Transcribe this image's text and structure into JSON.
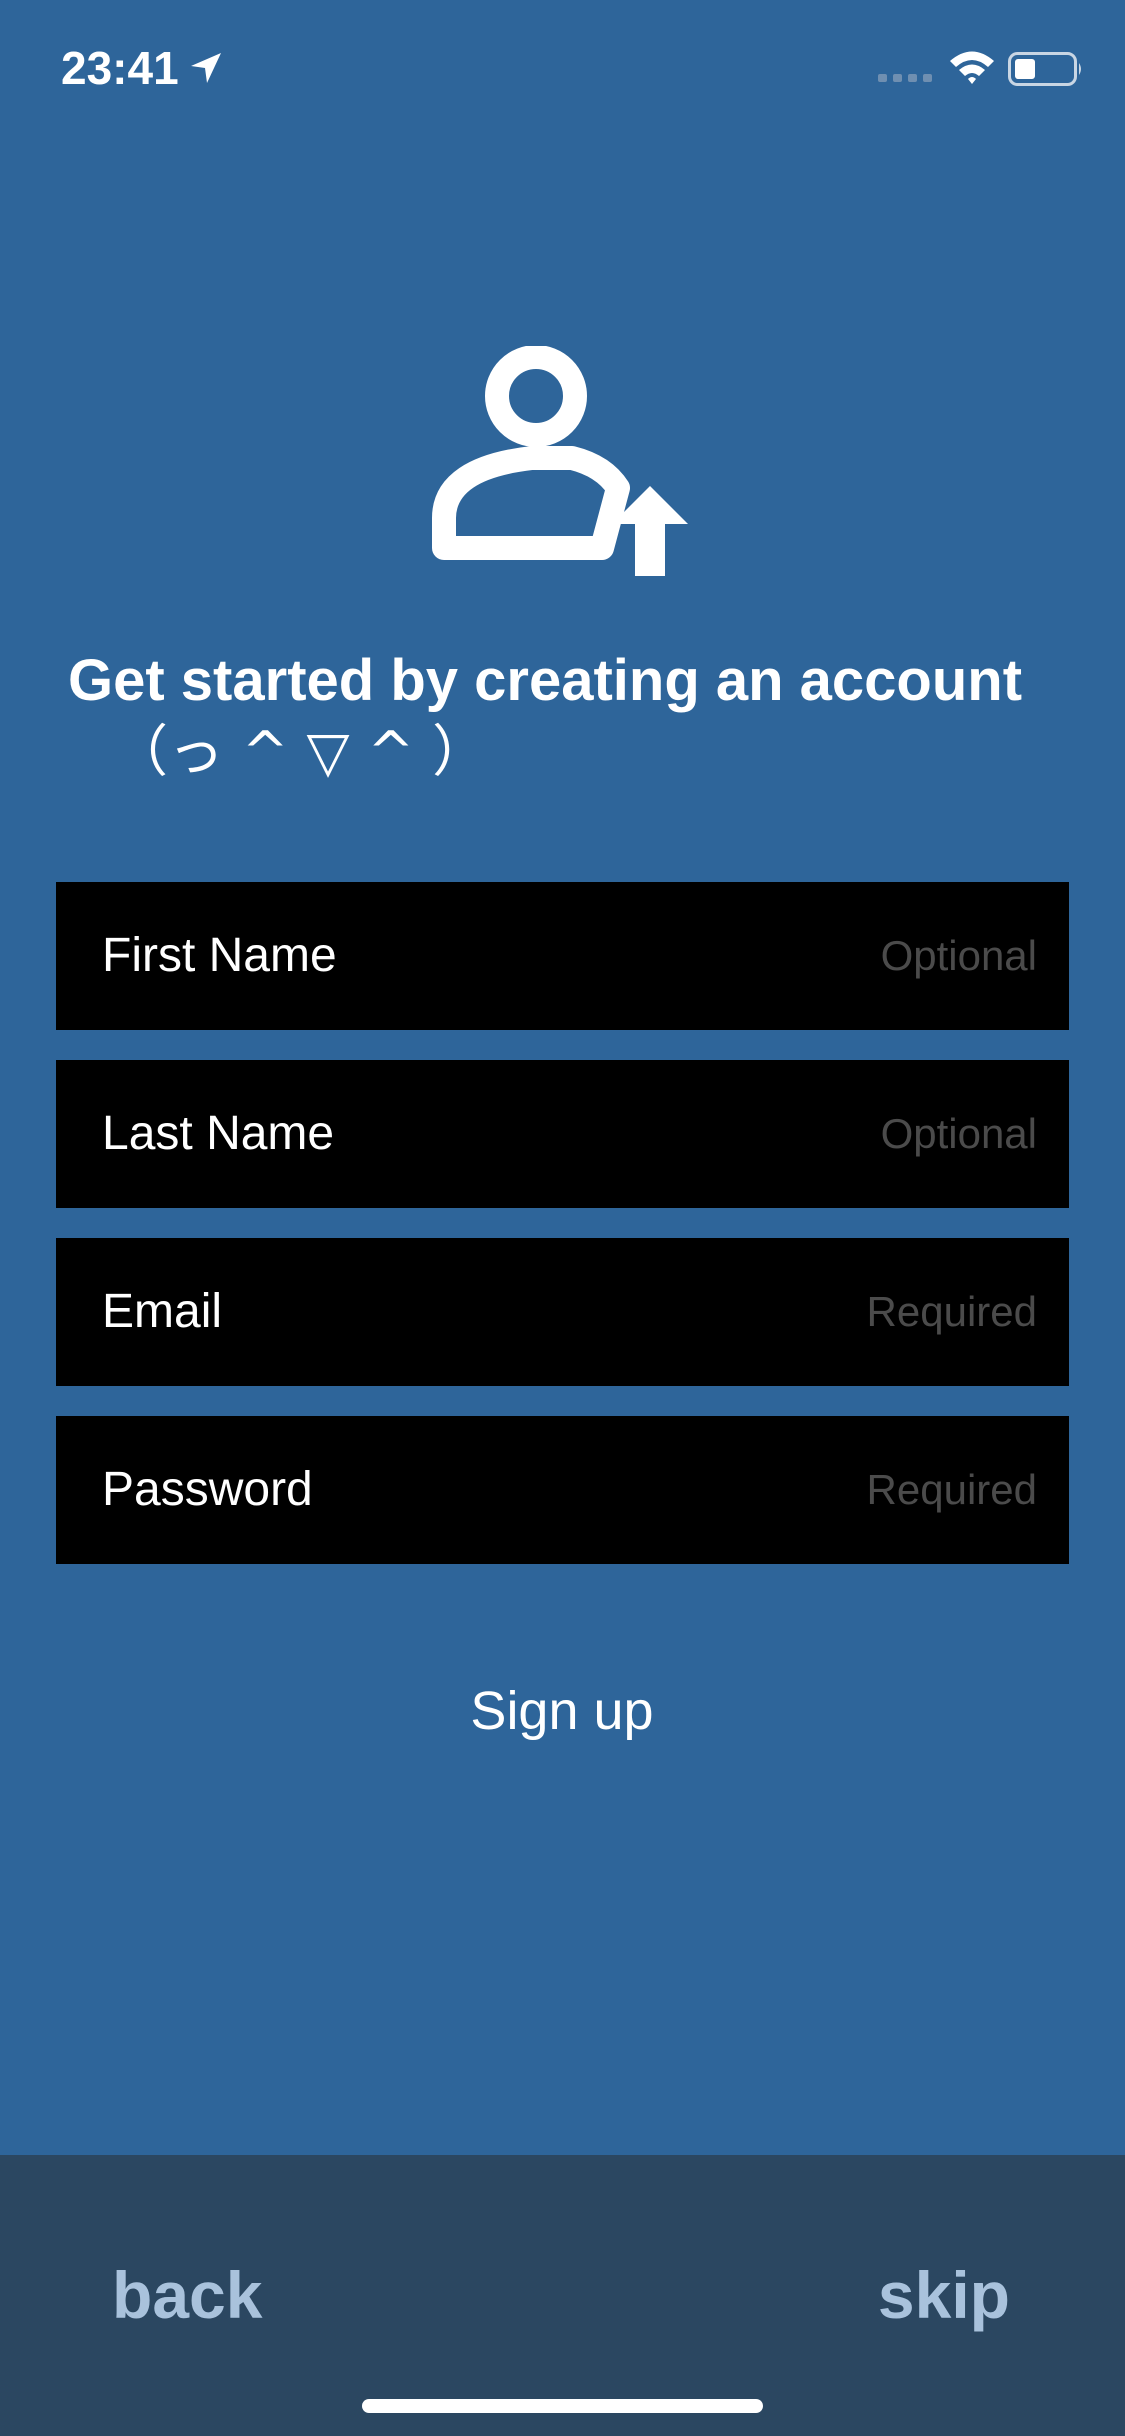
{
  "status_bar": {
    "time": "23:41",
    "icons": [
      "location-arrow-icon",
      "cellular-signal-icon",
      "wifi-icon",
      "battery-icon"
    ]
  },
  "hero": {
    "icon": "person-upload-icon",
    "headline": "Get started by creating an account",
    "kaomoji": "（っ ^ ▽ ^ ）"
  },
  "form": {
    "first_name": {
      "label": "First Name",
      "placeholder": "Optional",
      "value": ""
    },
    "last_name": {
      "label": "Last Name",
      "placeholder": "Optional",
      "value": ""
    },
    "email": {
      "label": "Email",
      "placeholder": "Required",
      "value": ""
    },
    "password": {
      "label": "Password",
      "placeholder": "Required",
      "value": ""
    }
  },
  "signup_label": "Sign up",
  "bottom_bar": {
    "back_label": "back",
    "skip_label": "skip"
  },
  "colors": {
    "background": "#2e659a",
    "field_background": "#000000",
    "bottom_bar": "#2b4761",
    "bottom_text": "#a9c2dc",
    "placeholder": "#4b4b4b",
    "foreground": "#ffffff"
  }
}
